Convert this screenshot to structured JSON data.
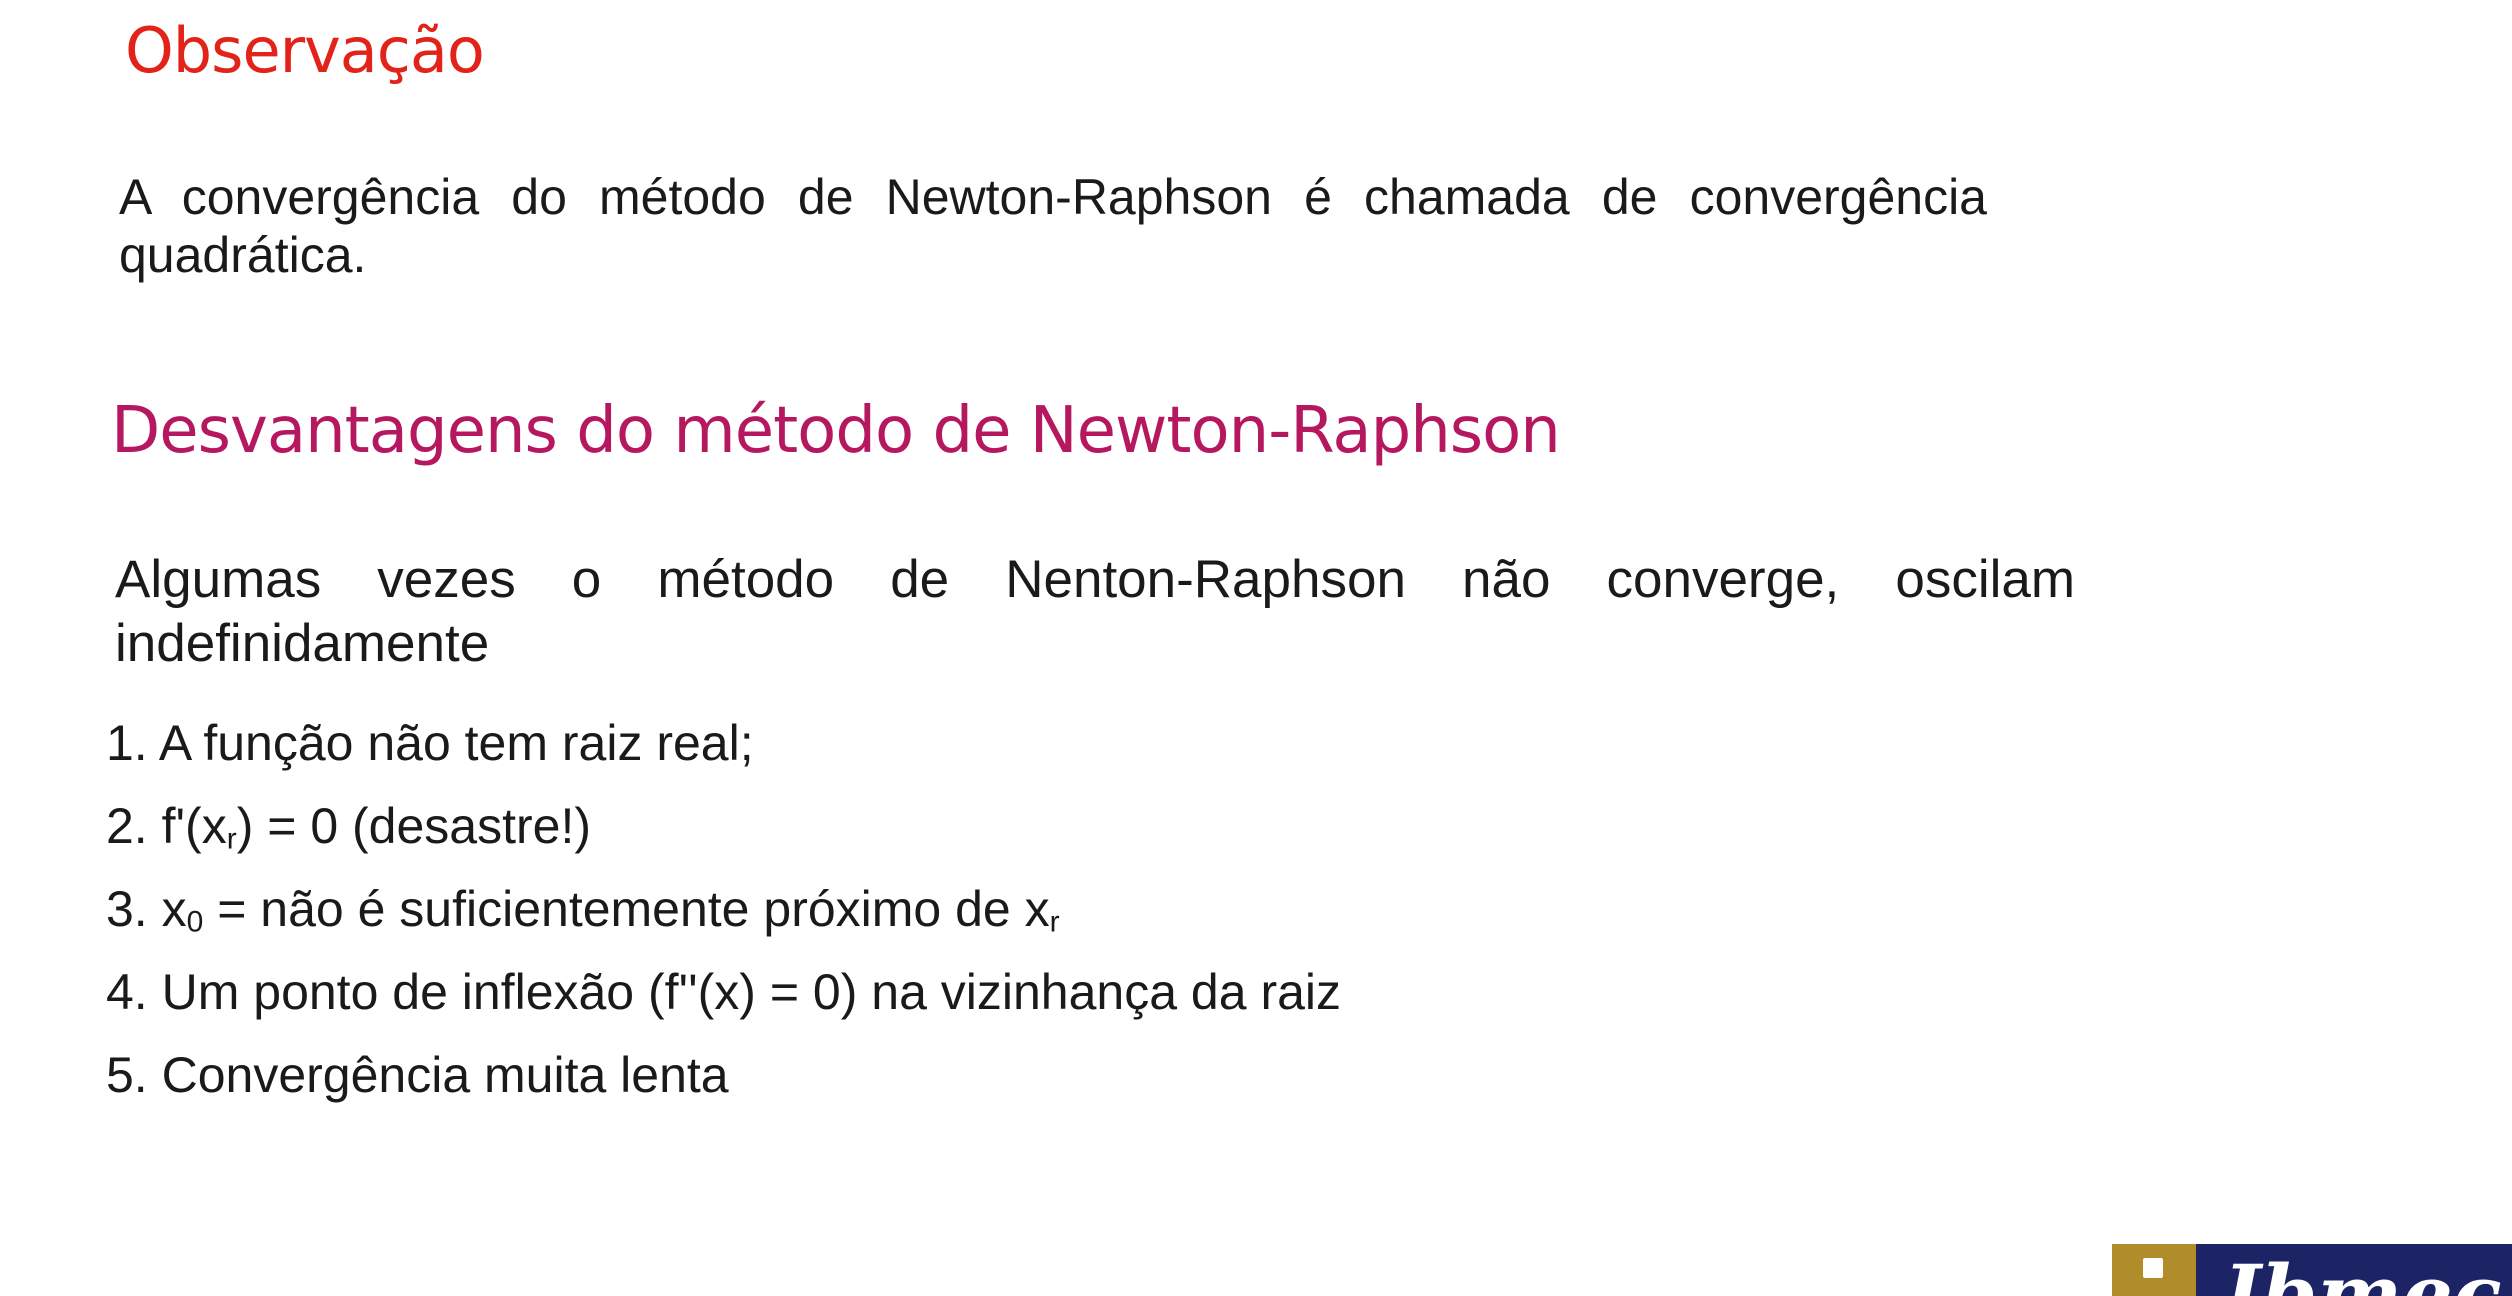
{
  "observacao": {
    "title": "Observação",
    "text": "A convergência do método de Newton-Raphson é chamada de convergência quadrática."
  },
  "desvantagens": {
    "title": "Desvantagens do método de Newton-Raphson",
    "intro": "Algumas vezes o método de Nenton-Raphson não converge, oscilam indefinidamente",
    "items": [
      {
        "num": "1.",
        "text": "A função não tem raiz real;"
      },
      {
        "num": "2.",
        "pre": "f'(x",
        "sub": "r",
        "post": ") = 0 (desastre!)"
      },
      {
        "num": "3.",
        "pre": "x",
        "sub": "0",
        "mid": " = não é suficientemente próximo de x",
        "sub2": "r"
      },
      {
        "num": "4.",
        "text": "Um ponto de inflexão (f''(x) = 0) na vizinhança da raiz"
      },
      {
        "num": "5.",
        "text": "Convergência muita lenta"
      }
    ]
  },
  "logo": {
    "brand": "Ibmec"
  },
  "colors": {
    "observacao_title": "#e2231a",
    "desvantagens_title": "#b5185f",
    "body_text": "#1a1a1a",
    "logo_navy": "#1c2466",
    "logo_gold": "#b08d2a"
  }
}
